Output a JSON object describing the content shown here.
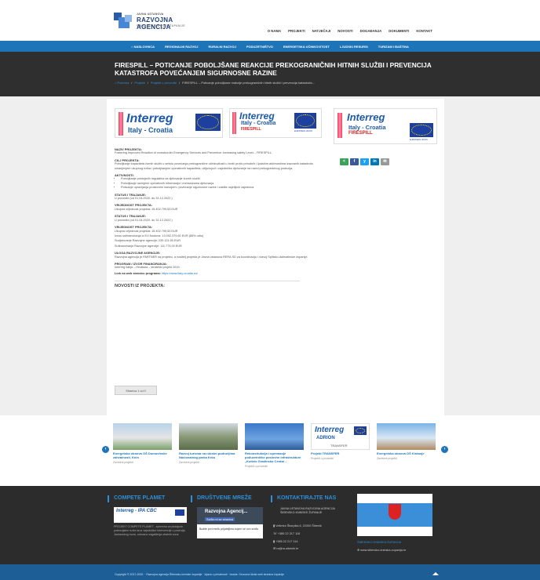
{
  "header": {
    "logo_small": "JAVNA USTANOVA",
    "logo_big": "RAZVOJNA AGENCIJA",
    "logo_sub": "ŠIBENSKO-KNINSKE ŽUPANIJE",
    "top_nav": [
      "O NAMA",
      "PROJEKTI",
      "NATJEČAJI",
      "NOVOSTI",
      "DOGAĐANJA",
      "DOKUMENTI",
      "KONTAKT"
    ]
  },
  "main_nav": [
    "⌂ NASLOVNICA",
    "REGIONALNI RAZVOJ",
    "RURALNI RAZVOJ",
    "PODUZETNIŠTVO",
    "ENERGETSKA UČINKOVITOST",
    "LJUDSKI RESURSI",
    "TURIZAM I BAŠTINA"
  ],
  "page": {
    "title": "FIRESPILL – POTICANJE POBOLJŠANE REAKCIJE PREKOGRANIČNIH HITNIH SLUŽBI I PREVENCIJA KATASTROFA POVEĆANJEM SIGURNOSNE RAZINE",
    "breadcrumb": [
      "⌂ Početna",
      "/",
      "Projekti",
      "/",
      "Projekti u provedbi",
      "/",
      "FIRESPILL – Poticanje poboljšane reakcije prekograničnih hitnih službi i prevencija katastrofa..."
    ]
  },
  "banners": {
    "interreg": "Interreg",
    "italy_croatia": "Italy - Croatia",
    "firespill": "FIRESPILL",
    "eu": "EUROPEAN UNION"
  },
  "content": {
    "naziv_label": "NAZIV PROJEKTA:",
    "naziv": "Fostering Improved Reaction of crossborder Emergency Services and Prevention Increasing safety LeveL - FIRESPILL",
    "cilj_label": "CILJ PROJEKTA:",
    "cilj": "Poboljšanje kapaciteta žurnih službi u smislu povećanja prekogranične učinkovitosti u borbi protiv prirodnih i ljudskim aktivnostima izazvanih katastrofa smanjenjem ukupnog rizika i poboljšanjem operativnih kapaciteta, uključujući i zajedničko djelovanje na razini prekograničnog područja.",
    "aktivnosti_label": "AKTIVNOSTI:",
    "aktivnosti": [
      "Poboljšanje postojećih regulativa za djelovanje žurnih službi",
      "Poboljšanje razmjene operativnih informacija i mehanizama djelovanja",
      "Poticanje upravljanja prostornim razvojem i povećanje sigurnosne razine i zaštite osjetljivih zajednica"
    ],
    "status_label": "STATUS I TRAJANJE:",
    "status": "U provedbi (od 01.04.2020. do 31.12.2022.)",
    "vrijednost_label": "VRIJEDNOST PROJEKTA:",
    "vrijednost": "Ukupna vrijednost projekta: 15.402.799,53 EUR",
    "status_label2": "STATUS I TRAJANJE:",
    "status2": "U provedbi (od 01.04.2020. do 31.12.2022.)",
    "vrijednost_label2": "VRIJEDNOST PROJEKTA:",
    "vrijednost_lines": [
      "Ukupna vrijednost projekta: 15.402.799,53 EUR",
      "Iznos sufinanciranja iz EU fondova: 13.092.379,60 EUR (85% udio)",
      "Sudjelovanje Razvojne agencije: 230.124,50 EUR",
      "Sufinanciranje Razvojne agencije: 111.773,00 EUR"
    ],
    "uloga_label": "ULOGA RAZVOJNE AGENCIJE:",
    "uloga": "Razvojna agencija je PARTNER na projektu, a nositelj projekta je Javna ustanova RERA SD za koordinaciju i razvoj Splitsko-dalmatinske županije.",
    "program_label": "PROGRAM / IZVOR FINANCIRANJA:",
    "program": "Interreg Italija – Hrvatska – strateški projekt 2019.",
    "link_label": "Link na web stranicu programa:",
    "link": "https://www.italy-croatia.eu/",
    "news_title": "NOVOSTI IZ PROJEKTA:",
    "page_button": "Stranica 1 od 0"
  },
  "share": [
    "<",
    "f",
    "y",
    "in",
    "✉"
  ],
  "carousel": [
    {
      "title": "Energetska obnova OŠ Domovinske zahvalnosti, Knin",
      "sub": "Završeni projekti"
    },
    {
      "title": "Razvoj turizma na rubnim područjima Nacionalnog parka Krka",
      "sub": "Završeni projekti"
    },
    {
      "title": "Rekonstrukcija i opremanje poduzetničke poslovne infrastrukture „Kotlelo Gradinsko Centar –",
      "sub": "Projekti u provedbi"
    },
    {
      "title": "Projekt TRANSFER",
      "sub": "Projekti u provedbi"
    },
    {
      "title": "Energetska obnova OŠ Kistanje",
      "sub": "Završeni projekti"
    }
  ],
  "carousel_logo": {
    "interreg": "Interreg",
    "adrion": "ADRION",
    "transfer": "TRANSFER"
  },
  "footer": {
    "col1_title": "COMPETE PLAMET",
    "col1_logo": "Interreg - IPA CBC",
    "col1_text": "PROJEKT COMPETE PLAMET - spremna za plutajuće potencijalne rizike kroz zajedničke intervencije u području Jadranskog mora, odnosno zagađenja obalnih zona",
    "col2_title": "DRUŠTVENE MREŽE",
    "col2_page": "Razvojna Agencij...",
    "col2_like": "Sviđa mi se stranica",
    "col2_text": "Budite prvi među prijateljima kojem se ovo sviđa",
    "col3_title": "KONTAKTIRAJTE NAS",
    "col3_name": "JAVNA USTANOVA RAZVOJNA AGENCIJA ŠIBENSKO-KNINSKE ŽUPANIJE",
    "col3_address": "Velimira Škorpika 6, 22000 Šibenik",
    "col3_phone1": "+385 22 217 118",
    "col3_phone2": "+385 22 217 114",
    "col3_email": "ra@ra-sibenik.hr",
    "col4_text": "ŠIBENSKO-KNINSKA ŽUPANIJA",
    "col4_link": "www.sibensko-kninska-zupanija.hr",
    "copyright": "Copyright © 2017-2020. · Razvojna agencija Šibensko-kninske županije · Izjava o privatnosti · Izrada: Osnovna škola web stranica županije"
  },
  "colors": {
    "primary": "#1d75b7",
    "dark": "#2f2f2f",
    "footer": "#2c2c2c",
    "bottom": "#1d5e96"
  }
}
